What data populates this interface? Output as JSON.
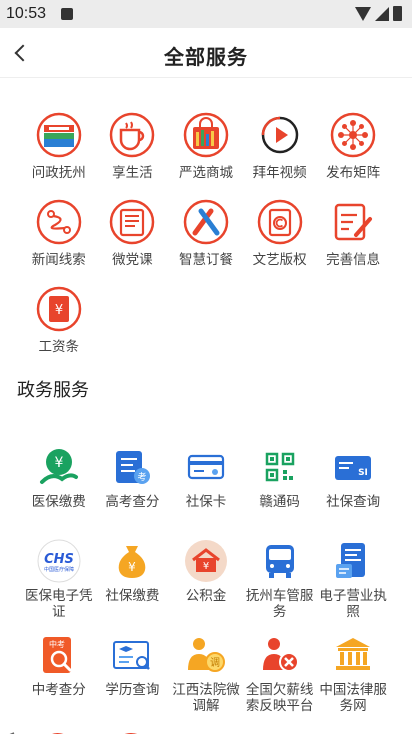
{
  "status": {
    "time": "10:53"
  },
  "header": {
    "title": "全部服务"
  },
  "top_services": [
    {
      "label": "问政抚州",
      "icon": "wenzheng-icon"
    },
    {
      "label": "享生活",
      "icon": "cup-icon"
    },
    {
      "label": "严选商城",
      "icon": "shopping-bag-icon"
    },
    {
      "label": "拜年视频",
      "icon": "play-icon"
    },
    {
      "label": "发布矩阵",
      "icon": "network-icon"
    },
    {
      "label": "新闻线索",
      "icon": "line-icon"
    },
    {
      "label": "微党课",
      "icon": "book-icon"
    },
    {
      "label": "智慧订餐",
      "icon": "utensils-icon"
    },
    {
      "label": "文艺版权",
      "icon": "copyright-icon"
    },
    {
      "label": "完善信息",
      "icon": "edit-icon"
    },
    {
      "label": "工资条",
      "icon": "salary-icon"
    }
  ],
  "gov": {
    "title": "政务服务",
    "items": [
      {
        "label": "医保缴费",
        "icon": "medical-pay-icon"
      },
      {
        "label": "高考查分",
        "icon": "exam-icon"
      },
      {
        "label": "社保卡",
        "icon": "card-icon"
      },
      {
        "label": "赣通码",
        "icon": "qr-icon"
      },
      {
        "label": "社保查询",
        "icon": "si-query-icon"
      },
      {
        "label": "医保电子凭证",
        "icon": "chs-icon",
        "logo_text": "CHS",
        "logo_sub": "中国医疗保障"
      },
      {
        "label": "社保缴费",
        "icon": "money-bag-icon"
      },
      {
        "label": "公积金",
        "icon": "fund-icon"
      },
      {
        "label": "抚州车管服务",
        "icon": "bus-icon"
      },
      {
        "label": "电子营业执照",
        "icon": "license-icon"
      },
      {
        "label": "中考查分",
        "icon": "zhongkao-icon",
        "badge": "中考"
      },
      {
        "label": "学历查询",
        "icon": "degree-icon"
      },
      {
        "label": "江西法院微调解",
        "icon": "court-icon"
      },
      {
        "label": "全国欠薪线索反映平台",
        "icon": "wage-report-icon"
      },
      {
        "label": "中国法律服务网",
        "icon": "law-icon"
      }
    ]
  }
}
